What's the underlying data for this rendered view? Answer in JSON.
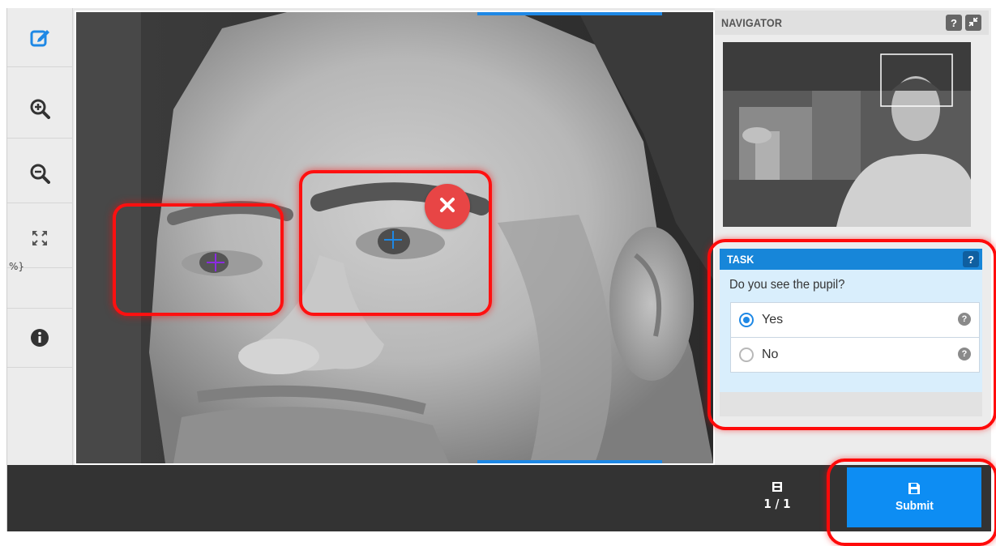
{
  "toolbar": {
    "items": [
      {
        "name": "edit-icon",
        "active": true
      },
      {
        "name": "zoom-in-icon"
      },
      {
        "name": "zoom-out-icon"
      },
      {
        "name": "fullscreen-icon"
      },
      {
        "name": "info-icon"
      }
    ],
    "stray_text": "%}"
  },
  "annotations": [
    {
      "label": "pupil-left",
      "point_color": "#8b2be2",
      "selected": false
    },
    {
      "label": "pupil-right",
      "point_color": "#1e88e5",
      "selected": true
    }
  ],
  "navigator": {
    "title": "NAVIGATOR",
    "help_icon": "?",
    "collapse_icon": "collapse-icon"
  },
  "task": {
    "title": "TASK",
    "help_icon": "?",
    "question": "Do you see the pupil?",
    "options": [
      {
        "label": "Yes",
        "selected": true,
        "help": "?"
      },
      {
        "label": "No",
        "selected": false,
        "help": "?"
      }
    ]
  },
  "footer": {
    "counter": "1 / 1",
    "submit_label": "Submit"
  },
  "colors": {
    "accent": "#1e88e5",
    "submit": "#0d8df3",
    "highlight": "#ff1010",
    "delete": "#e84545",
    "bar": "#333333"
  }
}
